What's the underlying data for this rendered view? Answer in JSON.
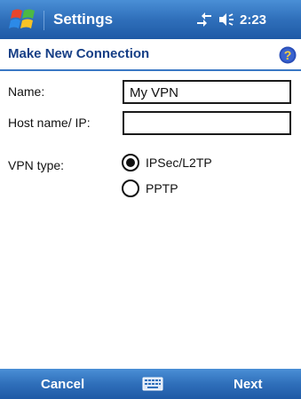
{
  "titlebar": {
    "app_title": "Settings",
    "clock": "2:23",
    "icons": [
      "windows-start-icon",
      "connectivity-icon",
      "speaker-icon"
    ]
  },
  "header": {
    "title": "Make New Connection",
    "help_icon": "help-icon"
  },
  "form": {
    "name_label": "Name:",
    "name_value": "My VPN",
    "host_label": "Host name/ IP:",
    "host_value": "",
    "vpn_type_label": "VPN type:",
    "vpn_options": [
      {
        "label": "IPSec/L2TP",
        "selected": true
      },
      {
        "label": "PPTP",
        "selected": false
      }
    ]
  },
  "softkeys": {
    "left": "Cancel",
    "right": "Next",
    "center_icon": "keyboard-icon"
  },
  "colors": {
    "bar": "#2f6fba",
    "title_text": "#163f86",
    "help": "#2a4fb8"
  }
}
